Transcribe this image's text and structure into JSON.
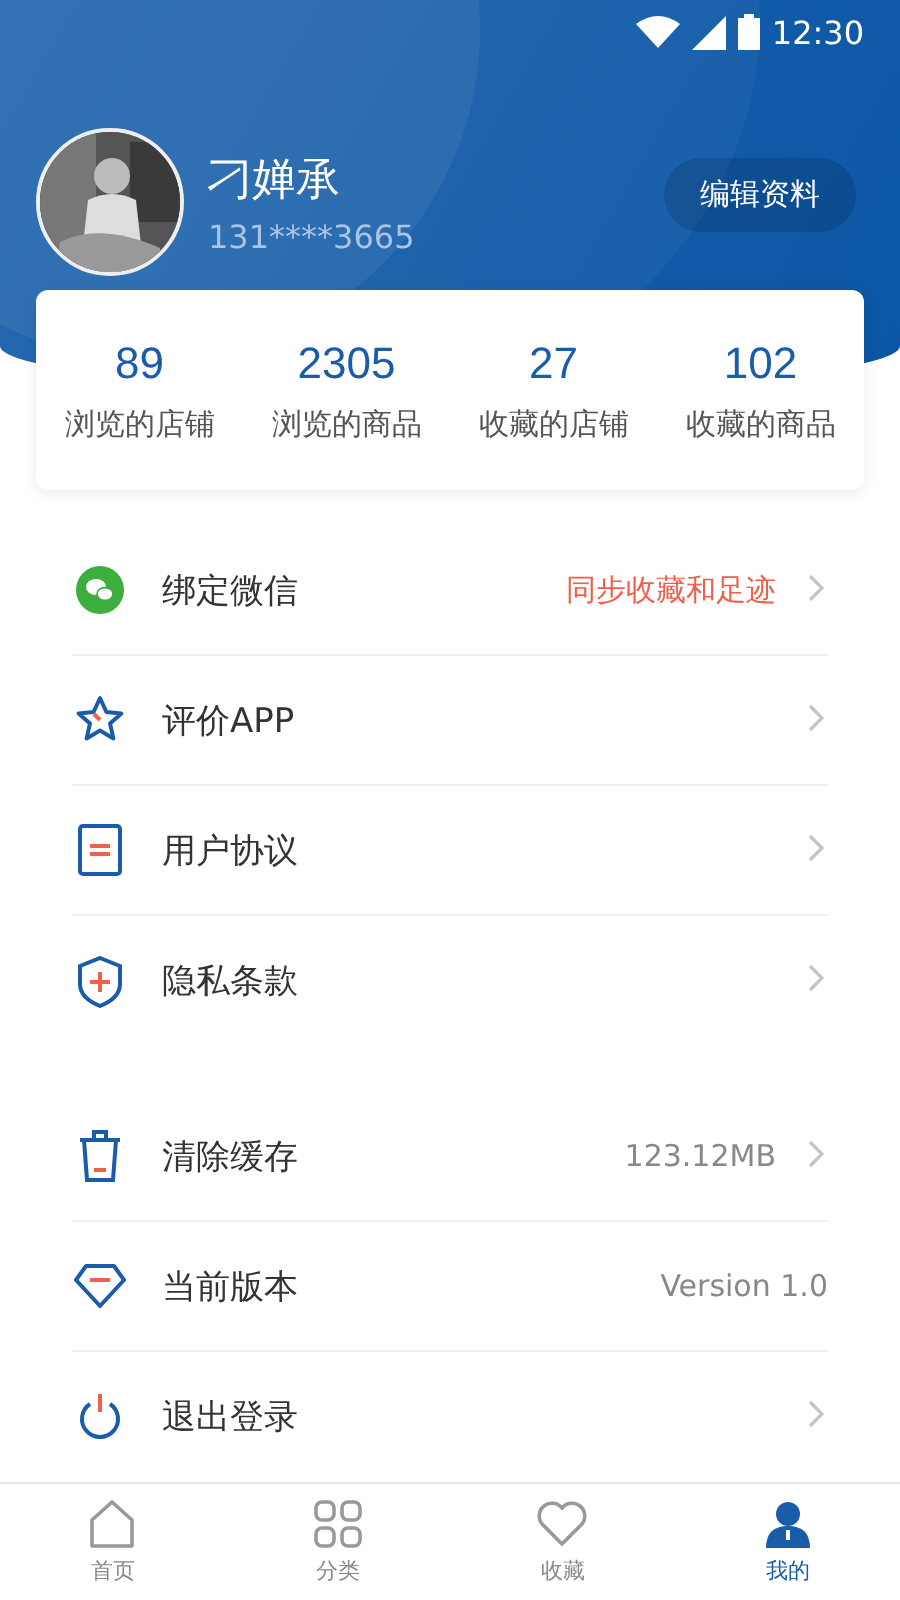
{
  "status_bar": {
    "time": "12:30"
  },
  "profile": {
    "name": "刁婵承",
    "phone": "131****3665",
    "edit_button": "编辑资料"
  },
  "stats": [
    {
      "value": "89",
      "label": "浏览的店铺"
    },
    {
      "value": "2305",
      "label": "浏览的商品"
    },
    {
      "value": "27",
      "label": "收藏的店铺"
    },
    {
      "value": "102",
      "label": "收藏的商品"
    }
  ],
  "menu_groups": [
    {
      "items": [
        {
          "label": "绑定微信",
          "value": "同步收藏和足迹",
          "highlighted": true,
          "has_arrow": true
        },
        {
          "label": "评价APP",
          "has_arrow": true
        },
        {
          "label": "用户协议",
          "has_arrow": true
        },
        {
          "label": "隐私条款",
          "has_arrow": true
        }
      ]
    },
    {
      "items": [
        {
          "label": "清除缓存",
          "value": "123.12MB",
          "highlighted": false,
          "has_arrow": true
        },
        {
          "label": "当前版本",
          "value": "Version 1.0",
          "highlighted": false,
          "has_arrow": false
        },
        {
          "label": "退出登录",
          "has_arrow": true
        }
      ]
    }
  ],
  "tab_bar": [
    {
      "label": "首页",
      "selected": false
    },
    {
      "label": "分类",
      "selected": false
    },
    {
      "label": "收藏",
      "selected": false
    },
    {
      "label": "我的",
      "selected": true
    }
  ]
}
